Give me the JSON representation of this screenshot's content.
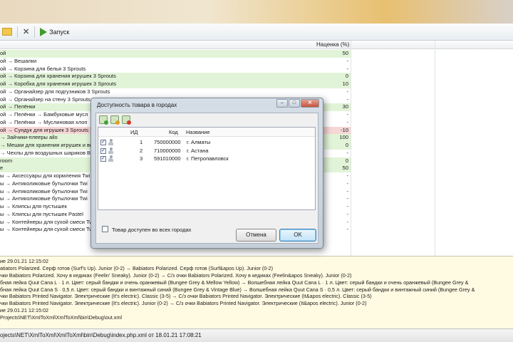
{
  "toolbar": {
    "run_label": "Запуск"
  },
  "grid": {
    "markup_header": "Наценка (%)",
    "rows": [
      {
        "name": "ой",
        "value": "50",
        "style": "green"
      },
      {
        "name": "ой → Вешалки",
        "value": "-",
        "style": "white"
      },
      {
        "name": "ой → Корзина для белья 3 Sprouts",
        "value": "-",
        "style": "white"
      },
      {
        "name": "ой → Корзина для хранения игрушек 3 Sprouts",
        "value": "0",
        "style": "green"
      },
      {
        "name": "ой → Коробка для хранения игрушек 3 Sprouts",
        "value": "10",
        "style": "green"
      },
      {
        "name": "ой → Органайзер для подгузников 3 Sprouts",
        "value": "-",
        "style": "white"
      },
      {
        "name": "ой → Органайзер на стену 3 Sprouts",
        "value": "-",
        "style": "white"
      },
      {
        "name": "ой → Пелёнки",
        "value": "30",
        "style": "green"
      },
      {
        "name": "ой → Пелёнки → Бамбуковые мусл",
        "value": "-",
        "style": "white"
      },
      {
        "name": "ой → Пелёнки → Муслиновая хлоп",
        "value": "-",
        "style": "white"
      },
      {
        "name": "ой → Сундук для игрушек 3 Sprouts",
        "value": "-10",
        "style": "red"
      },
      {
        "name": "→ Зайчики-плееры ailo",
        "value": "100",
        "style": "green"
      },
      {
        "name": "→ Мешки для хранения игрушек и ве",
        "value": "0",
        "style": "green"
      },
      {
        "name": "→ Чехлы для воздушных шариков Bo",
        "value": "-",
        "style": "white"
      },
      {
        "name": "room",
        "value": "0",
        "style": "green"
      },
      {
        "name": "e",
        "value": "50",
        "style": "green"
      },
      {
        "name": "ы → Аксессуары для кормления Twi",
        "value": "-",
        "style": "white"
      },
      {
        "name": "ы → Антиколиковые бутылочки Twi",
        "value": "-",
        "style": "white"
      },
      {
        "name": "ы → Антиколиковые бутылочки Twi",
        "value": "-",
        "style": "white"
      },
      {
        "name": "ы → Антиколиковые бутылочки Twi",
        "value": "-",
        "style": "white"
      },
      {
        "name": "ы → Клипсы для пустышек",
        "value": "-",
        "style": "white"
      },
      {
        "name": "ы → Клипсы для пустышек Pastel",
        "value": "-",
        "style": "white"
      },
      {
        "name": "ы → Контейнеры для сухой смеси Tw",
        "value": "-",
        "style": "white"
      },
      {
        "name": "ы → Контейнеры для сухой смеси Twistshake Pastel",
        "value": "-",
        "style": "white"
      }
    ]
  },
  "log": [
    "ие 29.01.21 12:15:02",
    "atiators Polarized. Серф готов (Surf's Up). Junior (0-2) → Babiators Polarized. Серф готов (Surf&apos Up). Junior (0-2)",
    "чки Babiators Polarized. Хочу в кедиках (Feelin' Sneaky). Junior (0-2) → С/з очки Babiators Polarized. Хочу в кедиках (Feelin&apos Sneaky). Junior (0-2)",
    "бная лейка Quut Cana L · 1 л. Цвет: серый бандки и очень оранжевый (Bungee Grey & Mellow Yellow) → Волшебная лейка Quut Cana L · 1 л. Цвет: серый бандки и очень оранжевый (Bungee Grey &",
    "бная лейка Quut Cana S · 0,5 л. Цвет: серый бандки и винтажный синий (Bungee Grey & Vintage Blue) → Волшебная лейка Quut Cana S · 0,5 л. Цвет: серый бандки и винтажный синий (Bungee Grey &",
    "чки Babiators Printed Navigator. Электрические (It's electric). Classic (3-5) → С/з очки Babiators Printed Navigator. Электрические (It&apos electric). Classic (3-5)",
    "чки Babiators Printed Navigator. Электрические (It's electric). Junior (0-2) → С/з очки Babiators Printed Navigator. Электрические (It&apos electric). Junior (0-2)",
    "ие 29.01.21 12:15:02",
    "Projects\\NET\\XmlToXml\\XmlToXml\\bin\\Debug\\out.xml"
  ],
  "status": {
    "text": "ojects\\NET\\XmlToXml\\XmlToXml\\bin\\Debug\\index.php.xml от 18.01.21 17:08:21"
  },
  "dialog": {
    "title": "Доступность товара в городах",
    "columns": {
      "id": "ИД",
      "code": "Код",
      "name": "Название"
    },
    "rows": [
      {
        "id": "1",
        "code": "750000000",
        "name": "г. Алматы",
        "checked": true
      },
      {
        "id": "2",
        "code": "710000000",
        "name": "г. Астана",
        "checked": true
      },
      {
        "id": "3",
        "code": "591010000",
        "name": "г. Петропавловск",
        "checked": true
      }
    ],
    "all_cities_label": "Товар доступен во всех городах",
    "cancel_label": "Отмена",
    "ok_label": "OK"
  }
}
